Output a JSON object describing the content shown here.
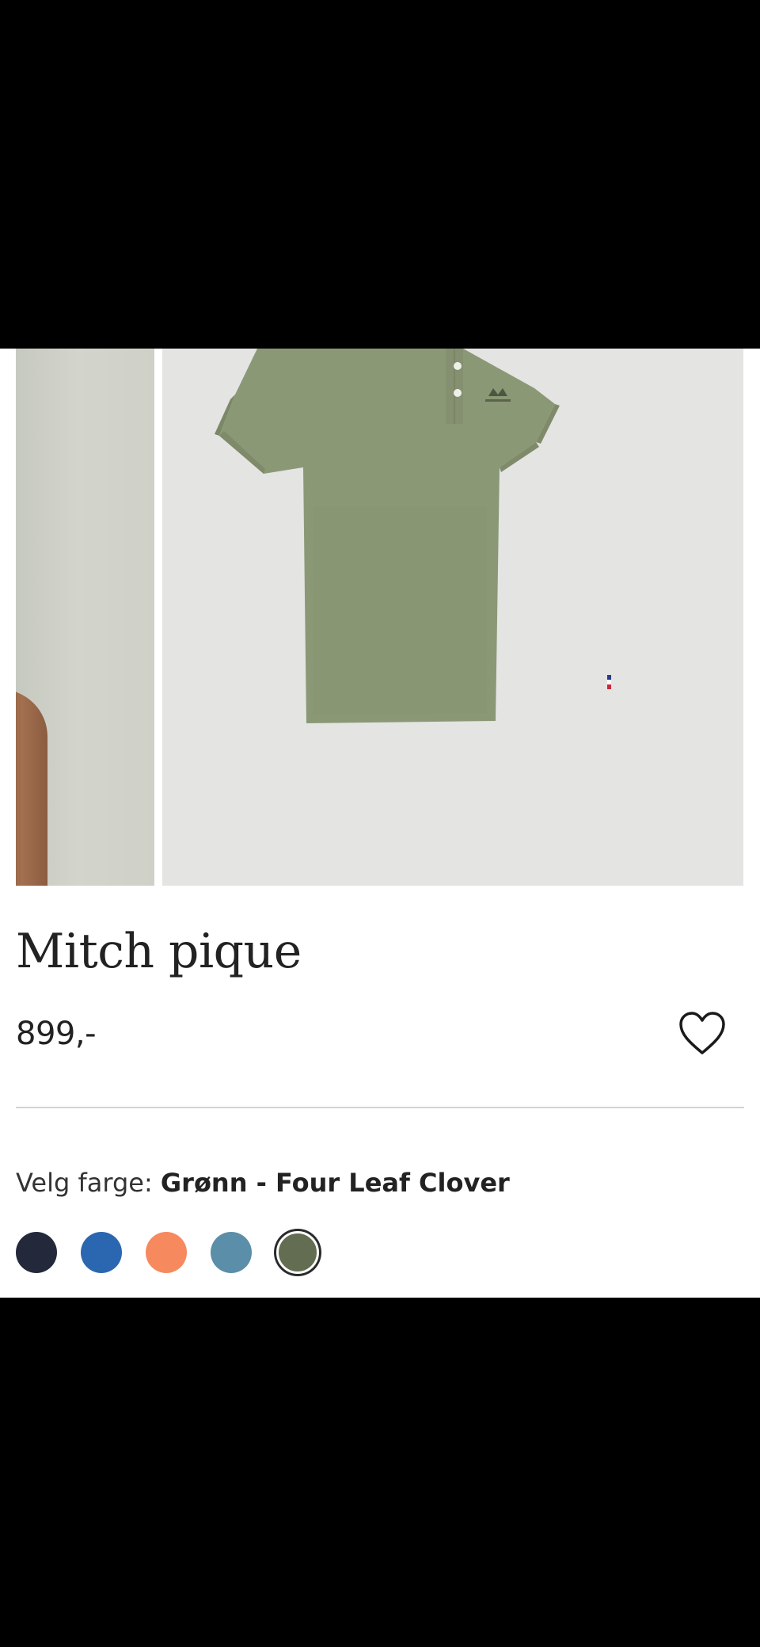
{
  "product": {
    "title": "Mitch pique",
    "price": "899,-"
  },
  "color_picker": {
    "label": "Velg farge:",
    "selected": "Grønn - Four Leaf Clover",
    "swatches": [
      {
        "name": "navy",
        "color": "#23293a"
      },
      {
        "name": "blue",
        "color": "#2b67b1"
      },
      {
        "name": "orange",
        "color": "#f7895e"
      },
      {
        "name": "steel-blue",
        "color": "#5b8ea8"
      },
      {
        "name": "green",
        "color": "#626d52",
        "selected": true
      }
    ]
  },
  "icons": {
    "wishlist": "heart-outline-icon"
  },
  "colors": {
    "shirt": "#8b9876",
    "image_background": "#e4e4e3",
    "divider": "#d3d3d3"
  }
}
